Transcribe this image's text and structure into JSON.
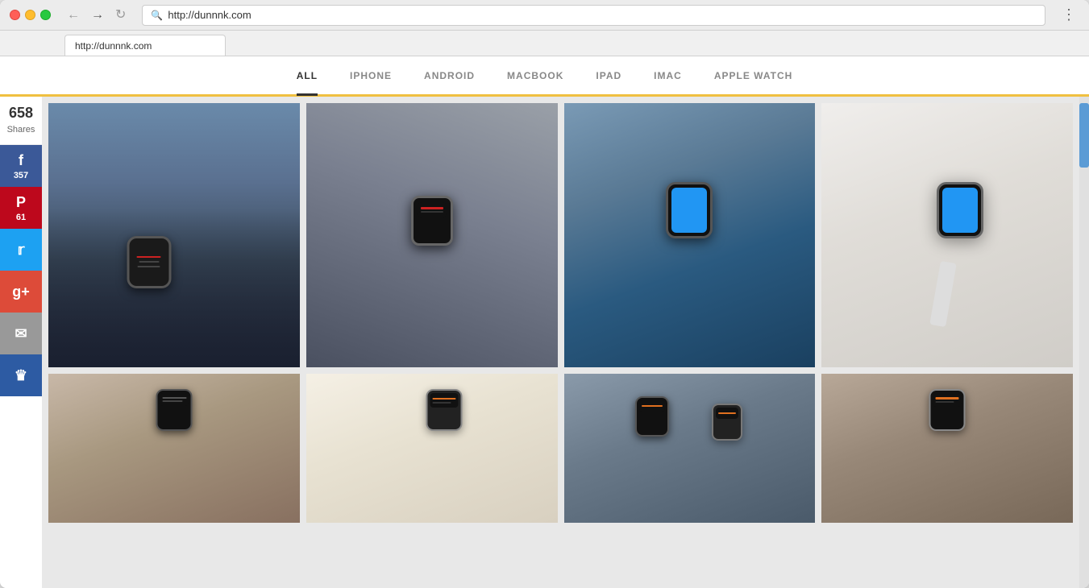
{
  "browser": {
    "tab_title": "http://dunnnk.com",
    "url": "http://dunnnk.com",
    "menu_icon": "⋮"
  },
  "nav": {
    "items": [
      {
        "id": "all",
        "label": "ALL",
        "active": true
      },
      {
        "id": "iphone",
        "label": "IPHONE",
        "active": false
      },
      {
        "id": "android",
        "label": "ANDROID",
        "active": false
      },
      {
        "id": "macbook",
        "label": "MACBOOK",
        "active": false
      },
      {
        "id": "ipad",
        "label": "IPAD",
        "active": false
      },
      {
        "id": "imac",
        "label": "IMAC",
        "active": false
      },
      {
        "id": "apple-watch",
        "label": "APPLE WATCH",
        "active": false
      }
    ]
  },
  "social": {
    "total_shares": "658",
    "shares_label": "Shares",
    "buttons": [
      {
        "id": "facebook",
        "icon": "f",
        "count": "357",
        "class": "facebook"
      },
      {
        "id": "pinterest",
        "icon": "P",
        "count": "61",
        "class": "pinterest"
      },
      {
        "id": "twitter",
        "icon": "t",
        "count": "",
        "class": "twitter"
      },
      {
        "id": "googleplus",
        "icon": "g+",
        "count": "",
        "class": "googleplus"
      },
      {
        "id": "email",
        "icon": "✉",
        "count": "",
        "class": "email"
      },
      {
        "id": "crown",
        "icon": "♛",
        "count": "",
        "class": "crown"
      }
    ]
  },
  "gallery": {
    "top_row": [
      {
        "id": 1,
        "scene": "scene-1",
        "screen_type": "dark",
        "alt": "Apple Watch on wrist blue shirt"
      },
      {
        "id": 2,
        "scene": "scene-2",
        "screen_type": "dark_red",
        "alt": "Apple Watch on crossed hands"
      },
      {
        "id": 3,
        "scene": "scene-3",
        "screen_type": "blue",
        "alt": "Apple Watch blue screen sleeve"
      },
      {
        "id": 4,
        "scene": "scene-4",
        "screen_type": "blue",
        "alt": "Apple Watch on light background"
      }
    ],
    "bottom_row": [
      {
        "id": 5,
        "scene": "scene-5",
        "screen_type": "dark",
        "alt": "Apple Watch woman wrist"
      },
      {
        "id": 6,
        "scene": "scene-6",
        "screen_type": "dark",
        "alt": "Apple Watch white background"
      },
      {
        "id": 7,
        "scene": "scene-7",
        "screen_type": "orange",
        "alt": "Apple Watch multiple"
      },
      {
        "id": 8,
        "scene": "scene-8",
        "screen_type": "orange",
        "alt": "Apple Watch close up"
      }
    ]
  }
}
